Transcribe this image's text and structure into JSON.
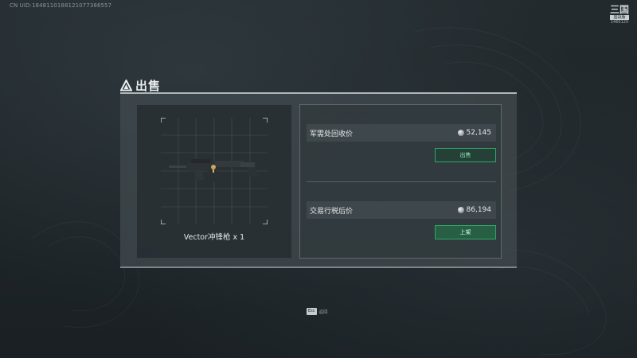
{
  "header": {
    "uid": "CN UID:1848110188121077386557",
    "logo_text": "三国",
    "logo_badge": "国战版",
    "logo_num": "1460120"
  },
  "dialog": {
    "title": "出售",
    "item": {
      "name": "Vector冲锋枪 x 1",
      "icon": "smg-weapon-icon"
    },
    "recycle": {
      "label": "军需处回收价",
      "price": "52,145",
      "button": "出售"
    },
    "trade": {
      "label": "交易行税后价",
      "price": "86,194",
      "button": "上架"
    }
  },
  "footer": {
    "esc_key": "Esc",
    "esc_label": "返回"
  },
  "colors": {
    "accent_green": "#2fa66a",
    "panel": "#40494d",
    "text": "#e6eaeb"
  }
}
